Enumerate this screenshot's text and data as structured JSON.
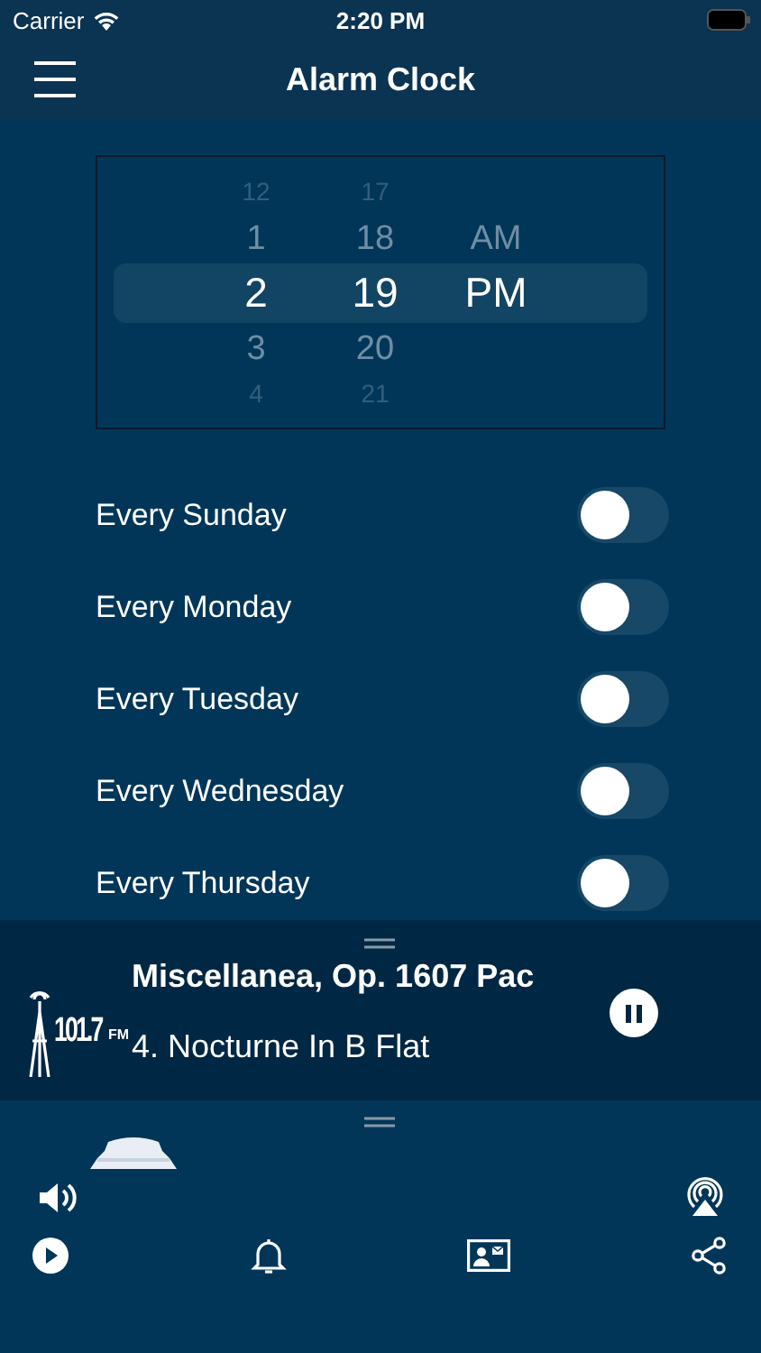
{
  "status_bar": {
    "carrier": "Carrier",
    "time": "2:20 PM"
  },
  "nav": {
    "title": "Alarm Clock"
  },
  "picker": {
    "columns": [
      {
        "kind": "hour",
        "items": [
          {
            "label": "12",
            "selected": false
          },
          {
            "label": "1",
            "selected": false
          },
          {
            "label": "2",
            "selected": true
          },
          {
            "label": "3",
            "selected": false
          },
          {
            "label": "4",
            "selected": false
          }
        ]
      },
      {
        "kind": "minute",
        "items": [
          {
            "label": "17",
            "selected": false
          },
          {
            "label": "18",
            "selected": false
          },
          {
            "label": "19",
            "selected": true
          },
          {
            "label": "20",
            "selected": false
          },
          {
            "label": "21",
            "selected": false
          }
        ]
      },
      {
        "kind": "period",
        "items": [
          {
            "label": "AM",
            "selected": false
          },
          {
            "label": "PM",
            "selected": true
          }
        ]
      }
    ]
  },
  "days": [
    {
      "label": "Every Sunday",
      "on": false
    },
    {
      "label": "Every Monday",
      "on": false
    },
    {
      "label": "Every Tuesday",
      "on": false
    },
    {
      "label": "Every Wednesday",
      "on": false
    },
    {
      "label": "Every Thursday",
      "on": false
    }
  ],
  "player": {
    "logo": {
      "number": "101.7",
      "band": "FM"
    },
    "title": "Miscellanea, Op. 1607 Pac",
    "subtitle": "4. Nocturne In B Flat",
    "playing": true
  },
  "toolbar": {
    "items": [
      {
        "kind": "play"
      },
      {
        "kind": "bell"
      },
      {
        "kind": "contact"
      },
      {
        "kind": "share"
      }
    ]
  }
}
